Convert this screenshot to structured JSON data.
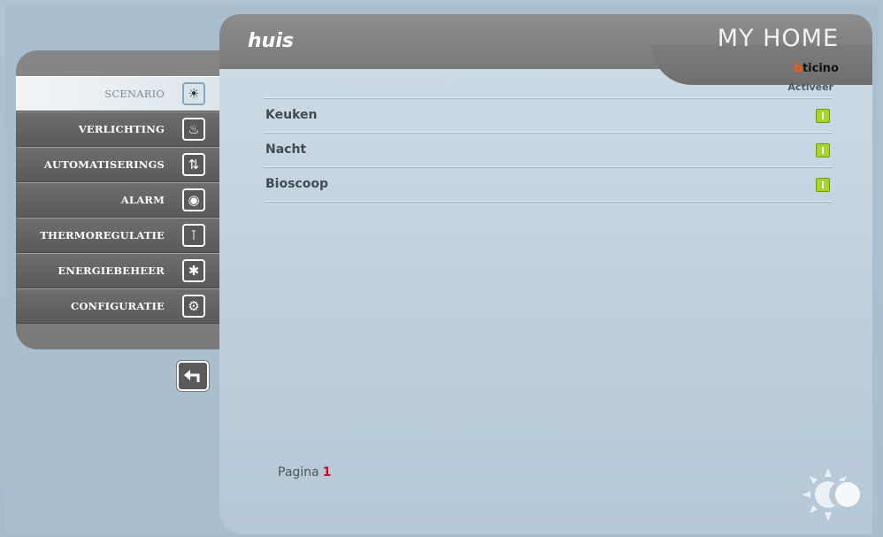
{
  "header": {
    "room_title": "huis",
    "brand_main": "MY HOME",
    "brand_sub_accent": "b",
    "brand_sub_rest": "ticino"
  },
  "list": {
    "column_header": "Activeer",
    "scenarios": [
      {
        "label": "Keuken"
      },
      {
        "label": "Nacht"
      },
      {
        "label": "Bioscoop"
      }
    ]
  },
  "sidebar": {
    "items": [
      {
        "label": "SCENARIO",
        "icon": "scenario-icon",
        "active": true
      },
      {
        "label": "VERLICHTING",
        "icon": "lightbulb-icon"
      },
      {
        "label": "AUTOMATISERINGS",
        "icon": "shutter-icon"
      },
      {
        "label": "ALARM",
        "icon": "alarm-icon"
      },
      {
        "label": "THERMOREGULATIE",
        "icon": "thermometer-icon"
      },
      {
        "label": "ENERGIEBEHEER",
        "icon": "energy-icon"
      },
      {
        "label": "CONFIGURATIE",
        "icon": "gears-icon"
      }
    ],
    "back_icon": "back-arrow-icon"
  },
  "footer": {
    "page_label": "Pagina",
    "page_number": "1"
  },
  "colors": {
    "accent_green": "#a8d42c",
    "page_number_red": "#c0121b",
    "brand_orange": "#ff5a00"
  }
}
